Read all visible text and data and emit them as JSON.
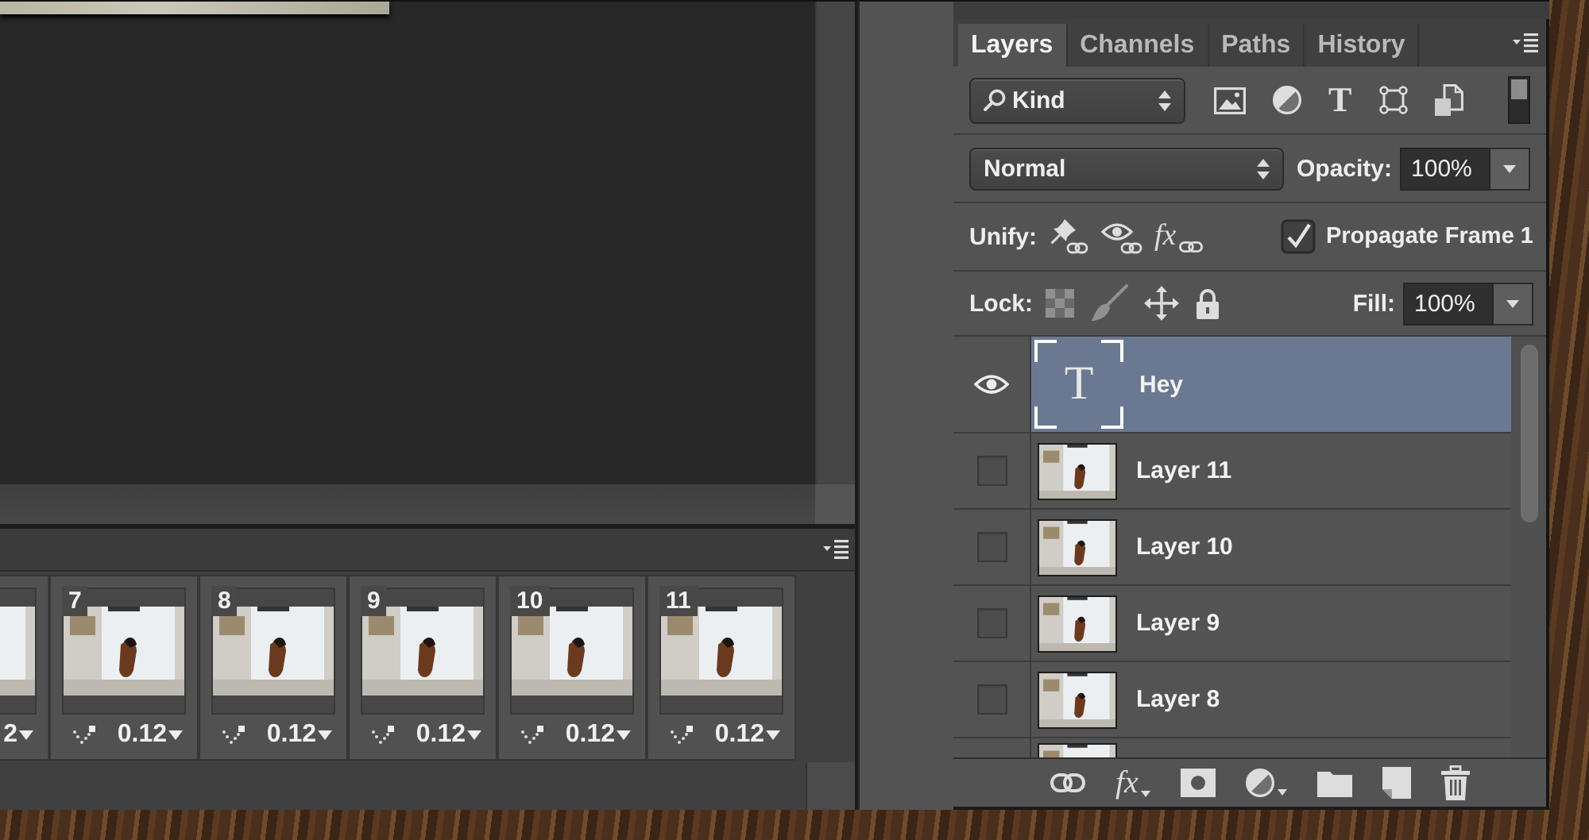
{
  "layers_panel": {
    "tabs": [
      {
        "label": "Layers",
        "selected": true
      },
      {
        "label": "Channels",
        "selected": false
      },
      {
        "label": "Paths",
        "selected": false
      },
      {
        "label": "History",
        "selected": false
      }
    ],
    "filter": {
      "value": "Kind",
      "type_glyph": "T",
      "enabled": true
    },
    "blend_mode": "Normal",
    "opacity": {
      "label": "Opacity:",
      "value": "100%"
    },
    "unify": {
      "label": "Unify:",
      "effects_glyph": "fx"
    },
    "propagate": {
      "label": "Propagate Frame 1",
      "checked": true
    },
    "lock": {
      "label": "Lock:"
    },
    "fill": {
      "label": "Fill:",
      "value": "100%"
    },
    "layers": [
      {
        "kind": "text",
        "glyph": "T",
        "name": "Hey",
        "visible": true,
        "selected": true
      },
      {
        "kind": "image",
        "name": "Layer 11",
        "visible": false,
        "selected": false
      },
      {
        "kind": "image",
        "name": "Layer 10",
        "visible": false,
        "selected": false
      },
      {
        "kind": "image",
        "name": "Layer 9",
        "visible": false,
        "selected": false
      },
      {
        "kind": "image",
        "name": "Layer 8",
        "visible": false,
        "selected": false
      },
      {
        "kind": "image",
        "selected": false
      }
    ],
    "footer": {
      "effects_glyph": "fx"
    }
  },
  "timeline": {
    "frames": [
      {
        "delay": "2"
      },
      {
        "number": "7",
        "delay": "0.12"
      },
      {
        "number": "8",
        "delay": "0.12"
      },
      {
        "number": "9",
        "delay": "0.12"
      },
      {
        "number": "10",
        "delay": "0.12"
      },
      {
        "number": "11",
        "delay": "0.12"
      }
    ]
  }
}
